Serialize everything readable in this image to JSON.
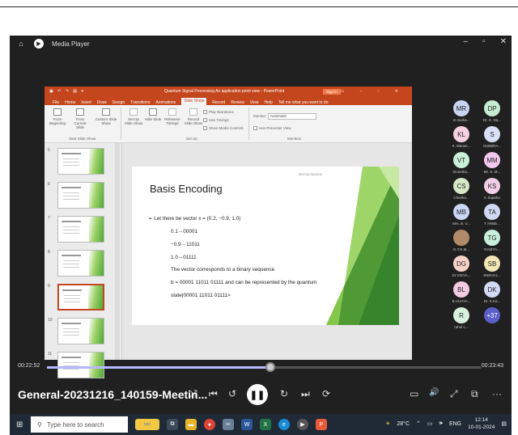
{
  "player": {
    "app_name": "Media Player",
    "time_elapsed": "00:22:52",
    "time_total": "00:23:43",
    "progress": 0.515,
    "file_name": "General-20231216_140159-Meetin...",
    "controls": {
      "shuffle": "⤭",
      "prev": "⏮",
      "rewind": "↺",
      "play_pause": "❚❚",
      "forward": "↻",
      "next": "⏭",
      "repeat": "⟳"
    },
    "right_controls": {
      "captions": "▭",
      "volume": "🔊",
      "fullscreen": "⤢",
      "miniplayer": "⧉",
      "more": "···"
    }
  },
  "ppt": {
    "title": "Quantum Signal Processing An application point view  -  PowerPoint",
    "sign_in": "Sign in",
    "menu": [
      "File",
      "Home",
      "Insert",
      "Draw",
      "Design",
      "Transitions",
      "Animations",
      "Slide Show",
      "Record",
      "Review",
      "View",
      "Help",
      "Tell me what you want to do"
    ],
    "ribbon": {
      "from_beginning": "From Beginning",
      "from_current": "From Current Slide",
      "custom_show": "Custom Slide Show",
      "group1": "Start Slide Show",
      "setup": "Set Up Slide Show",
      "hide": "Hide Slide",
      "rehearse": "Rehearse Timings",
      "record": "Record Slide Show",
      "play_narrations": "Play Narrations",
      "use_timings": "Use Timings",
      "show_media": "Show Media Controls",
      "group2": "Set Up",
      "monitor_label": "Monitor:",
      "monitor_value": "Automatic",
      "presenter_view": "Use Presenter View",
      "group3": "Monitors"
    },
    "thumb_numbers": [
      "5",
      "6",
      "7",
      "8",
      "9",
      "10",
      "11"
    ],
    "slide": {
      "ref": "[REF/NCTM/2023]",
      "title": "Basis Encoding",
      "lines": [
        "➢  Let there be vector x = (0.2, −0.9, 1.0)",
        "0.1→00001",
        "−0.9→11011",
        "1.0→01111",
        "The vector corresponds to a binary sequence",
        "b = 00001 11011 01111 and can be represented by the quantum",
        "state|00001 11011 01111>"
      ]
    }
  },
  "participants": [
    {
      "initials": "MR",
      "name": "m.ravika...",
      "color": "#c9d3f2"
    },
    {
      "initials": "DP",
      "name": "Dr. K. Na...",
      "color": "#c5ecd1"
    },
    {
      "initials": "KL",
      "name": "K. Manas...",
      "color": "#f6cfe0"
    },
    {
      "initials": "S",
      "name": "SUBBRA...",
      "color": "#d9e0f7"
    },
    {
      "initials": "VT",
      "name": "Vineetha...",
      "color": "#c9f0d8"
    },
    {
      "initials": "MM",
      "name": "Mr. S. M...",
      "color": "#f3c8ee"
    },
    {
      "initials": "CS",
      "name": "Chaitha...",
      "color": "#d6e8c5"
    },
    {
      "initials": "KS",
      "name": "K Sujatha",
      "color": "#f2cfe6"
    },
    {
      "initials": "MB",
      "name": "Mrs. B. V...",
      "color": "#c9d6f5"
    },
    {
      "initials": "TA",
      "name": "T ARBE...",
      "color": "#d0d8f2"
    },
    {
      "initials": "",
      "name": "G.T.N.M...",
      "color": "#b08a6a"
    },
    {
      "initials": "TG",
      "name": "RAMYA...",
      "color": "#c8eedc"
    },
    {
      "initials": "DG",
      "name": "Dr.VIDYA...",
      "color": "#f8d2c6"
    },
    {
      "initials": "SB",
      "name": "SNEHAL...",
      "color": "#f2e6b6"
    },
    {
      "initials": "BL",
      "name": "B.VIJAYA...",
      "color": "#f3cbe3"
    },
    {
      "initials": "DK",
      "name": "Dr. K.Ka...",
      "color": "#d4d9f5"
    },
    {
      "initials": "R",
      "name": "rahul L...",
      "color": "#d9f0dc"
    },
    {
      "initials": "+37",
      "name": "",
      "color": "#5b5fc7"
    }
  ],
  "taskbar": {
    "search_placeholder": "Type here to search",
    "weather": "28°C",
    "language": "ENG",
    "time": "12:14",
    "date": "10-01-2024"
  }
}
